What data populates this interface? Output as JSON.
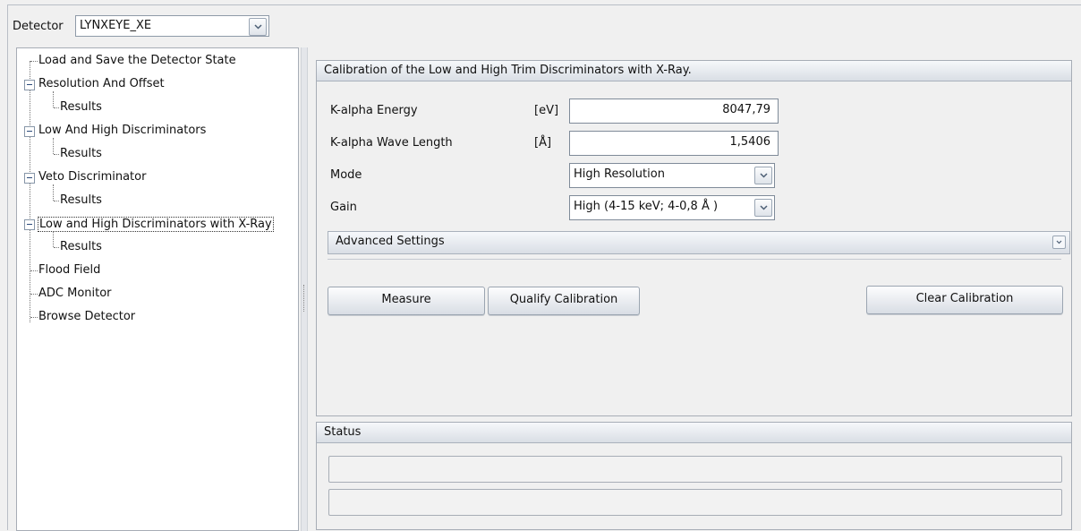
{
  "detector": {
    "label": "Detector",
    "selected": "LYNXEYE_XE"
  },
  "tree": {
    "items": [
      {
        "label": "Load and Save the Detector State"
      },
      {
        "label": "Resolution And Offset"
      },
      {
        "label": "Results"
      },
      {
        "label": "Low And High Discriminators"
      },
      {
        "label": "Results"
      },
      {
        "label": "Veto Discriminator"
      },
      {
        "label": "Results"
      },
      {
        "label": "Low and High Discriminators with X-Ray"
      },
      {
        "label": "Results"
      },
      {
        "label": "Flood Field"
      },
      {
        "label": "ADC Monitor"
      },
      {
        "label": "Browse Detector"
      }
    ]
  },
  "calibration": {
    "title": "Calibration of the Low and High Trim Discriminators  with X-Ray.",
    "k_alpha_energy": {
      "label": "K-alpha Energy",
      "unit": "[eV]",
      "value": "8047,79"
    },
    "k_alpha_wave": {
      "label": "K-alpha Wave Length",
      "unit": "[Å]",
      "value": "1,5406"
    },
    "mode": {
      "label": "Mode",
      "value": "High Resolution"
    },
    "gain": {
      "label": "Gain",
      "value": "High (4-15 keV; 4-0,8 Å )"
    },
    "advanced_label": "Advanced Settings",
    "buttons": {
      "measure": "Measure",
      "qualify": "Qualify Calibration",
      "clear": "Clear Calibration"
    }
  },
  "status": {
    "title": "Status",
    "line1": "",
    "line2": ""
  }
}
